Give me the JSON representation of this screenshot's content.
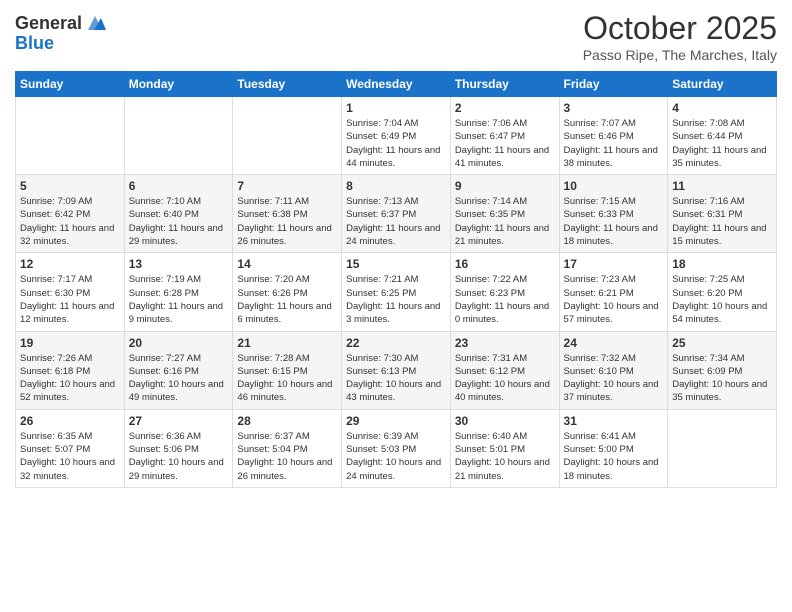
{
  "header": {
    "logo_general": "General",
    "logo_blue": "Blue",
    "month": "October 2025",
    "location": "Passo Ripe, The Marches, Italy"
  },
  "days_of_week": [
    "Sunday",
    "Monday",
    "Tuesday",
    "Wednesday",
    "Thursday",
    "Friday",
    "Saturday"
  ],
  "weeks": [
    [
      {
        "day": "",
        "info": ""
      },
      {
        "day": "",
        "info": ""
      },
      {
        "day": "",
        "info": ""
      },
      {
        "day": "1",
        "info": "Sunrise: 7:04 AM\nSunset: 6:49 PM\nDaylight: 11 hours and 44 minutes."
      },
      {
        "day": "2",
        "info": "Sunrise: 7:06 AM\nSunset: 6:47 PM\nDaylight: 11 hours and 41 minutes."
      },
      {
        "day": "3",
        "info": "Sunrise: 7:07 AM\nSunset: 6:46 PM\nDaylight: 11 hours and 38 minutes."
      },
      {
        "day": "4",
        "info": "Sunrise: 7:08 AM\nSunset: 6:44 PM\nDaylight: 11 hours and 35 minutes."
      }
    ],
    [
      {
        "day": "5",
        "info": "Sunrise: 7:09 AM\nSunset: 6:42 PM\nDaylight: 11 hours and 32 minutes."
      },
      {
        "day": "6",
        "info": "Sunrise: 7:10 AM\nSunset: 6:40 PM\nDaylight: 11 hours and 29 minutes."
      },
      {
        "day": "7",
        "info": "Sunrise: 7:11 AM\nSunset: 6:38 PM\nDaylight: 11 hours and 26 minutes."
      },
      {
        "day": "8",
        "info": "Sunrise: 7:13 AM\nSunset: 6:37 PM\nDaylight: 11 hours and 24 minutes."
      },
      {
        "day": "9",
        "info": "Sunrise: 7:14 AM\nSunset: 6:35 PM\nDaylight: 11 hours and 21 minutes."
      },
      {
        "day": "10",
        "info": "Sunrise: 7:15 AM\nSunset: 6:33 PM\nDaylight: 11 hours and 18 minutes."
      },
      {
        "day": "11",
        "info": "Sunrise: 7:16 AM\nSunset: 6:31 PM\nDaylight: 11 hours and 15 minutes."
      }
    ],
    [
      {
        "day": "12",
        "info": "Sunrise: 7:17 AM\nSunset: 6:30 PM\nDaylight: 11 hours and 12 minutes."
      },
      {
        "day": "13",
        "info": "Sunrise: 7:19 AM\nSunset: 6:28 PM\nDaylight: 11 hours and 9 minutes."
      },
      {
        "day": "14",
        "info": "Sunrise: 7:20 AM\nSunset: 6:26 PM\nDaylight: 11 hours and 6 minutes."
      },
      {
        "day": "15",
        "info": "Sunrise: 7:21 AM\nSunset: 6:25 PM\nDaylight: 11 hours and 3 minutes."
      },
      {
        "day": "16",
        "info": "Sunrise: 7:22 AM\nSunset: 6:23 PM\nDaylight: 11 hours and 0 minutes."
      },
      {
        "day": "17",
        "info": "Sunrise: 7:23 AM\nSunset: 6:21 PM\nDaylight: 10 hours and 57 minutes."
      },
      {
        "day": "18",
        "info": "Sunrise: 7:25 AM\nSunset: 6:20 PM\nDaylight: 10 hours and 54 minutes."
      }
    ],
    [
      {
        "day": "19",
        "info": "Sunrise: 7:26 AM\nSunset: 6:18 PM\nDaylight: 10 hours and 52 minutes."
      },
      {
        "day": "20",
        "info": "Sunrise: 7:27 AM\nSunset: 6:16 PM\nDaylight: 10 hours and 49 minutes."
      },
      {
        "day": "21",
        "info": "Sunrise: 7:28 AM\nSunset: 6:15 PM\nDaylight: 10 hours and 46 minutes."
      },
      {
        "day": "22",
        "info": "Sunrise: 7:30 AM\nSunset: 6:13 PM\nDaylight: 10 hours and 43 minutes."
      },
      {
        "day": "23",
        "info": "Sunrise: 7:31 AM\nSunset: 6:12 PM\nDaylight: 10 hours and 40 minutes."
      },
      {
        "day": "24",
        "info": "Sunrise: 7:32 AM\nSunset: 6:10 PM\nDaylight: 10 hours and 37 minutes."
      },
      {
        "day": "25",
        "info": "Sunrise: 7:34 AM\nSunset: 6:09 PM\nDaylight: 10 hours and 35 minutes."
      }
    ],
    [
      {
        "day": "26",
        "info": "Sunrise: 6:35 AM\nSunset: 5:07 PM\nDaylight: 10 hours and 32 minutes."
      },
      {
        "day": "27",
        "info": "Sunrise: 6:36 AM\nSunset: 5:06 PM\nDaylight: 10 hours and 29 minutes."
      },
      {
        "day": "28",
        "info": "Sunrise: 6:37 AM\nSunset: 5:04 PM\nDaylight: 10 hours and 26 minutes."
      },
      {
        "day": "29",
        "info": "Sunrise: 6:39 AM\nSunset: 5:03 PM\nDaylight: 10 hours and 24 minutes."
      },
      {
        "day": "30",
        "info": "Sunrise: 6:40 AM\nSunset: 5:01 PM\nDaylight: 10 hours and 21 minutes."
      },
      {
        "day": "31",
        "info": "Sunrise: 6:41 AM\nSunset: 5:00 PM\nDaylight: 10 hours and 18 minutes."
      },
      {
        "day": "",
        "info": ""
      }
    ]
  ]
}
